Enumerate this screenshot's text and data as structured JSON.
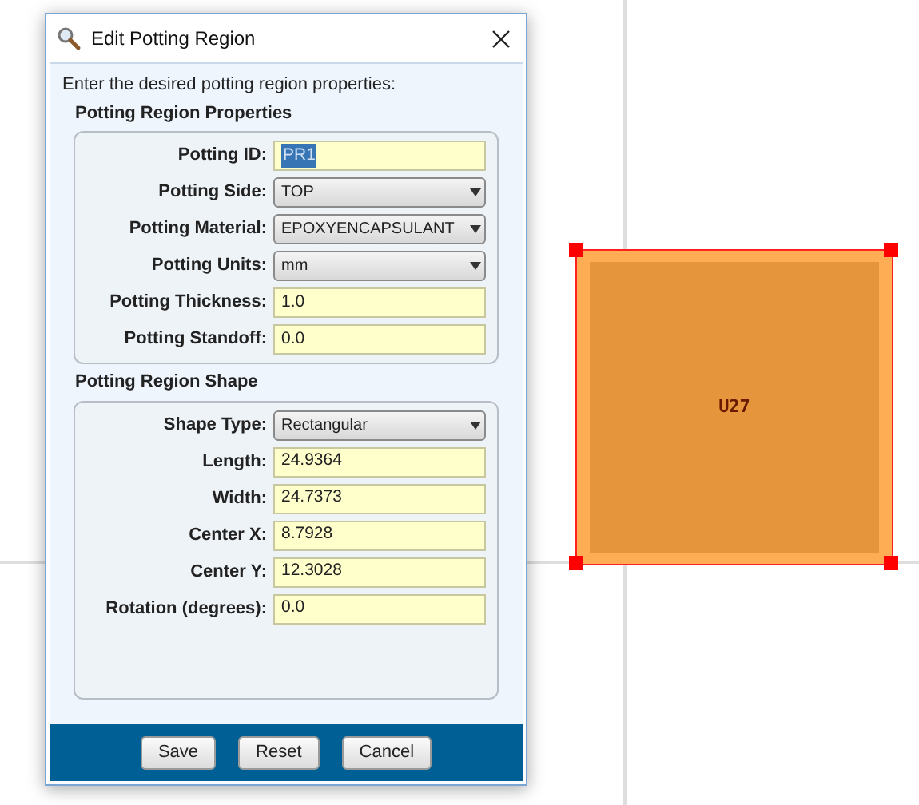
{
  "dialog": {
    "title": "Edit Potting Region",
    "instruction": "Enter the desired potting region properties:",
    "groups": [
      {
        "title": "Potting Region Properties",
        "fields": [
          {
            "kind": "text",
            "label": "Potting ID:",
            "value": "PR1",
            "text_selected": true
          },
          {
            "kind": "select",
            "label": "Potting Side:",
            "value": "TOP"
          },
          {
            "kind": "select",
            "label": "Potting Material:",
            "value": "EPOXYENCAPSULANT"
          },
          {
            "kind": "select",
            "label": "Potting Units:",
            "value": "mm"
          },
          {
            "kind": "text",
            "label": "Potting Thickness:",
            "value": "1.0",
            "text_selected": false
          },
          {
            "kind": "text",
            "label": "Potting Standoff:",
            "value": "0.0",
            "text_selected": false
          }
        ]
      },
      {
        "title": "Potting Region Shape",
        "fields": [
          {
            "kind": "select",
            "label": "Shape Type:",
            "value": "Rectangular"
          },
          {
            "kind": "text",
            "label": "Length:",
            "value": "24.9364",
            "text_selected": false
          },
          {
            "kind": "text",
            "label": "Width:",
            "value": "24.7373",
            "text_selected": false
          },
          {
            "kind": "text",
            "label": "Center X:",
            "value": "8.7928",
            "text_selected": false
          },
          {
            "kind": "text",
            "label": "Center Y:",
            "value": "12.3028",
            "text_selected": false
          },
          {
            "kind": "text",
            "label": "Rotation (degrees):",
            "value": "0.0",
            "text_selected": false
          }
        ]
      }
    ],
    "buttons": [
      "Save",
      "Reset",
      "Cancel"
    ]
  },
  "canvas": {
    "component": {
      "label": "U27",
      "selected": true
    }
  }
}
